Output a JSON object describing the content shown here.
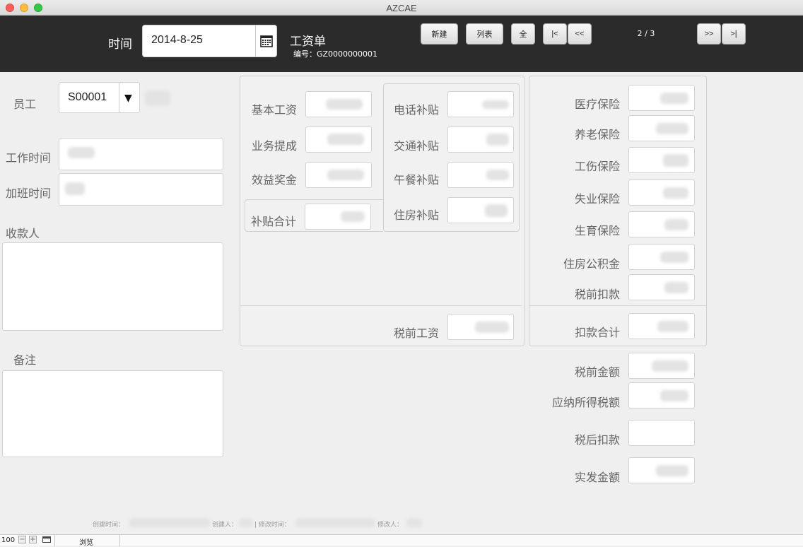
{
  "window": {
    "title": "AZCAE"
  },
  "header": {
    "date_label": "时间",
    "date_value": "2014-8-25",
    "form_title": "工资单",
    "number_text": "编号：GZ0000000001",
    "buttons": {
      "new": "新建",
      "list": "列表",
      "all": "全",
      "first": "|<",
      "prev": "<<",
      "next": ">>",
      "last": ">|"
    },
    "record_counter": "2 / 3"
  },
  "left": {
    "employee_label": "员工",
    "employee_value": "S00001",
    "work_time_label": "工作时间",
    "overtime_label": "加班时间",
    "payee_label": "收款人",
    "notes_label": "备注"
  },
  "middle": {
    "base_salary": "基本工资",
    "commission": "业务提成",
    "bonus": "效益奖金",
    "subsidy_total": "补贴合计",
    "phone_subsidy": "电话补贴",
    "transport_subsidy": "交通补贴",
    "lunch_subsidy": "午餐补贴",
    "housing_subsidy": "住房补贴",
    "pretax_salary": "税前工资"
  },
  "right": {
    "medical": "医疗保险",
    "pension": "养老保险",
    "injury": "工伤保险",
    "unemployment": "失业保险",
    "maternity": "生育保险",
    "housing_fund": "住房公积金",
    "pretax_deduction": "税前扣款",
    "deduction_total": "扣款合计",
    "pretax_amount": "税前金额",
    "taxable": "应纳所得税额",
    "aftertax_deduction": "税后扣款",
    "net_pay": "实发金额"
  },
  "footer": {
    "created_time": "创建时间：",
    "creator": "创建人：",
    "modified_time": "| 修改时间：",
    "modifier": "修改人："
  },
  "statusbar": {
    "zoom": "100",
    "mode": "浏览"
  },
  "colors": {
    "header_bg": "#2b2b2b",
    "close": "#fc605c",
    "minimize": "#fdbc40",
    "zoom": "#34c84a"
  }
}
